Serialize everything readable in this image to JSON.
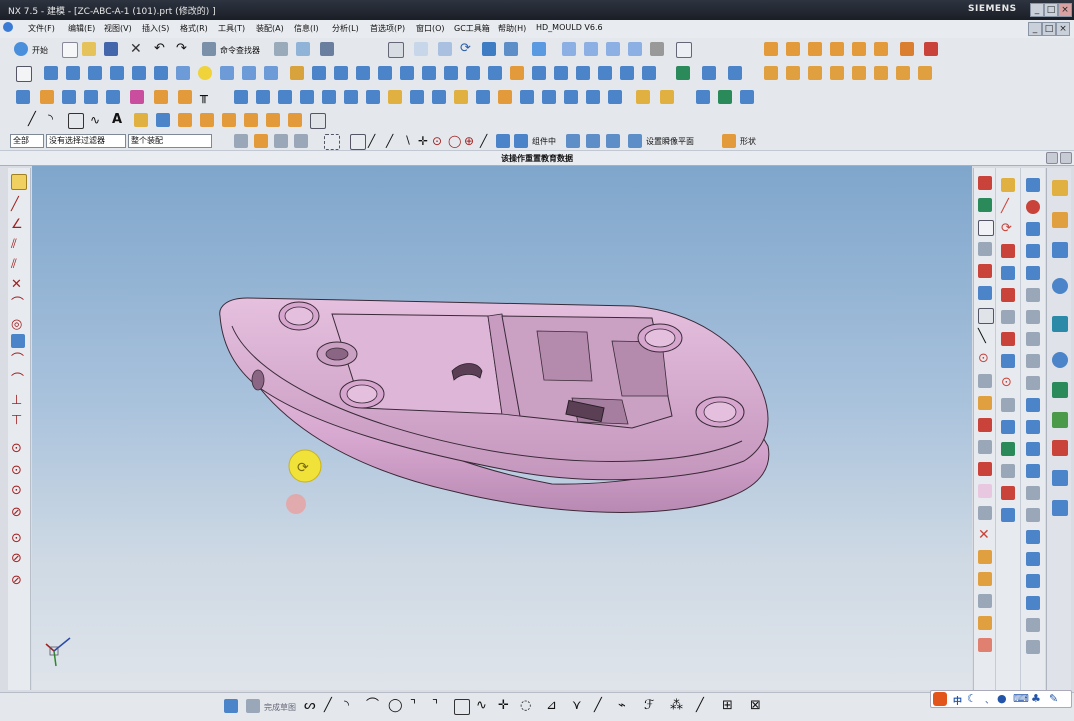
{
  "window": {
    "title": "NX 7.5 - 建模 - [ZC-ABC-A-1 (101).prt (修改的) ]",
    "brand": "SIEMENS",
    "controls": [
      "_",
      "□",
      "×"
    ]
  },
  "menubar": {
    "items": [
      "文件(F)",
      "编辑(E)",
      "视图(V)",
      "插入(S)",
      "格式(R)",
      "工具(T)",
      "装配(A)",
      "信息(I)",
      "分析(L)",
      "首选项(P)",
      "窗口(O)",
      "GC工具箱",
      "帮助(H)",
      "HD_MOULD V6.6"
    ],
    "doc_controls": [
      "_",
      "□",
      "×"
    ]
  },
  "toolbar_standard": {
    "start_label": "开始",
    "command_finder_label": "命令查找器"
  },
  "selection_bar": {
    "scope_value": "全部",
    "filter_value": "没有选择过滤器",
    "assembly_value": "整个装配",
    "component_label": "组件中",
    "work_plane_label": "设置瞬像平面",
    "shape_label": "形状"
  },
  "status": {
    "message": "该操作重置教育数据"
  },
  "bottom_bar": {
    "prompt_label": "完成草图"
  },
  "ime": {
    "lang_label": "中",
    "punct_label": "、"
  },
  "colors": {
    "part_fill": "#d6a6cf",
    "part_edge": "#3a2a38",
    "viewport_top": "#7fa6cc",
    "viewport_bottom": "#dfe4ea",
    "rotate_cursor": "#f1e23a",
    "title_bg": "#1a1e26"
  },
  "icons": {
    "rotate_cursor": "rotate-icon",
    "wcs_triad": "wcs-triad-icon"
  }
}
